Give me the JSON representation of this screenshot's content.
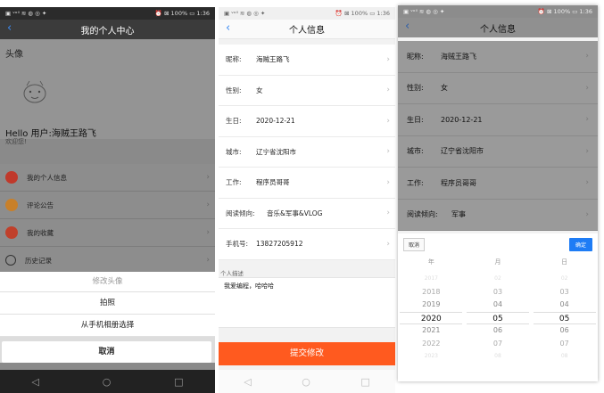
{
  "status": {
    "left": "▣ ᵛᵒˡˡ ≋ ◍ ◎ ✦",
    "right1": "⏰ ⊠ 100% ▭ 1:36"
  },
  "p1": {
    "title": "我的个人中心",
    "avatar_label": "头像",
    "hello": "Hello 用户:海贼王路飞",
    "welcome": "欢迎您!",
    "menu": [
      {
        "label": "我的个人信息",
        "color": "#c0392b"
      },
      {
        "label": "评论公告",
        "color": "#c8802a"
      },
      {
        "label": "我的收藏",
        "color": "#c0402b"
      },
      {
        "label": "历史记录",
        "color": "#333333"
      }
    ],
    "sheet": {
      "title": "修改头像",
      "photo": "拍照",
      "album": "从手机相册选择",
      "cancel": "取消"
    }
  },
  "p2": {
    "title": "个人信息",
    "rows": [
      {
        "k": "昵称:",
        "v": "海贼王路飞"
      },
      {
        "k": "性别:",
        "v": "女"
      },
      {
        "k": "生日:",
        "v": "2020-12-21"
      },
      {
        "k": "城市:",
        "v": "辽宁省沈阳市"
      },
      {
        "k": "工作:",
        "v": "程序员哥哥"
      },
      {
        "k": "阅读倾向:",
        "v": "音乐&军事&VLOG"
      },
      {
        "k": "手机号:",
        "v": "13827205912"
      }
    ],
    "memo_label": "个人描述",
    "memo": "我爱编程，哈哈哈",
    "submit": "提交修改"
  },
  "p3": {
    "title": "个人信息",
    "rows": [
      {
        "k": "昵称:",
        "v": "海贼王路飞"
      },
      {
        "k": "性别:",
        "v": "女"
      },
      {
        "k": "生日:",
        "v": "2020-12-21"
      },
      {
        "k": "城市:",
        "v": "辽宁省沈阳市"
      },
      {
        "k": "工作:",
        "v": "程序员哥哥"
      },
      {
        "k": "阅读倾向:",
        "v": "军事"
      }
    ],
    "picker": {
      "cancel": "取消",
      "ok": "确定",
      "heads": [
        "年",
        "月",
        "日"
      ],
      "years": [
        "2017",
        "2018",
        "2019",
        "2020",
        "2021",
        "2022",
        "2023"
      ],
      "months": [
        "02",
        "03",
        "04",
        "05",
        "06",
        "07",
        "08"
      ],
      "days": [
        "02",
        "03",
        "04",
        "05",
        "06",
        "07",
        "08"
      ]
    }
  },
  "nav": {
    "back": "◁",
    "home": "○",
    "recent": "□"
  }
}
